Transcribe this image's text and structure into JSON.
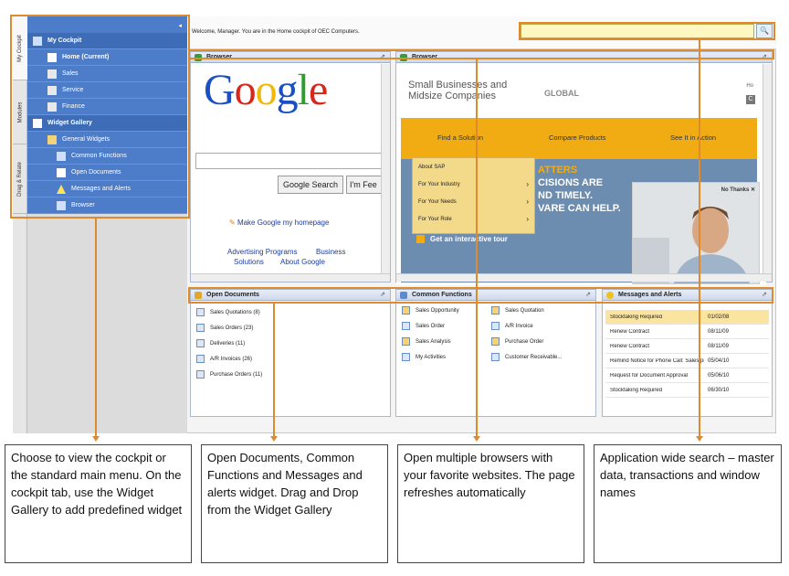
{
  "vtabs": [
    "My Cockpit",
    "Modules",
    "Drag & Relate"
  ],
  "menu": {
    "collapse_glyph": "◂",
    "items": [
      {
        "label": "My Cockpit",
        "bold": true,
        "indent": 6,
        "icon": "cockpit-icon"
      },
      {
        "label": "Home (Current)",
        "bold": true,
        "indent": 22,
        "icon": "home-icon"
      },
      {
        "label": "Sales",
        "bold": false,
        "indent": 22,
        "icon": "sales-icon"
      },
      {
        "label": "Service",
        "bold": false,
        "indent": 22,
        "icon": "service-icon"
      },
      {
        "label": "Finance",
        "bold": false,
        "indent": 22,
        "icon": "finance-icon"
      },
      {
        "label": "Widget Gallery",
        "bold": true,
        "indent": 6,
        "icon": "widget-gallery-icon"
      },
      {
        "label": "General Widgets",
        "bold": false,
        "indent": 22,
        "icon": "folder-icon"
      },
      {
        "label": "Common Functions",
        "bold": false,
        "indent": 32,
        "icon": "functions-icon"
      },
      {
        "label": "Open Documents",
        "bold": false,
        "indent": 32,
        "icon": "documents-icon"
      },
      {
        "label": "Messages and Alerts",
        "bold": false,
        "indent": 32,
        "icon": "alert-icon"
      },
      {
        "label": "Browser",
        "bold": false,
        "indent": 32,
        "icon": "browser-icon"
      }
    ]
  },
  "topbar": {
    "welcome": "Welcome, Manager. You are in the Home cockpit of OEC Computers.",
    "search_value": "",
    "search_button": "🔍"
  },
  "browser1": {
    "title": "Browser",
    "google_letters": [
      {
        "ch": "G",
        "color": "#1a4fc4"
      },
      {
        "ch": "o",
        "color": "#d8261b"
      },
      {
        "ch": "o",
        "color": "#f0b90a"
      },
      {
        "ch": "g",
        "color": "#1a4fc4"
      },
      {
        "ch": "l",
        "color": "#2b9e2b"
      },
      {
        "ch": "e",
        "color": "#d8261b"
      }
    ],
    "search_button": "Google Search",
    "lucky_button": "I'm Fee",
    "homepage_link": "Make Google my homepage",
    "link_ad": "Advertising Programs",
    "link_business": "Business",
    "link_solutions": "Solutions",
    "link_about": "About Google"
  },
  "browser2": {
    "title": "Browser",
    "header_line1": "Small Businesses and",
    "header_line2": "Midsize Companies",
    "global": "GLOBAL",
    "corner_text": "Ho",
    "corner_badge": "C",
    "nav": [
      "Find a Solution",
      "Compare Products",
      "See It in Action"
    ],
    "dropdown": [
      {
        "label": "About SAP",
        "arrow": ""
      },
      {
        "label": "For Your Industry",
        "arrow": "›"
      },
      {
        "label": "For Your Needs",
        "arrow": "›"
      },
      {
        "label": "For Your Role",
        "arrow": "›"
      }
    ],
    "big_lines": [
      "ATTERS",
      "CISIONS ARE",
      "ND TIMELY.",
      "VARE CAN HELP."
    ],
    "tour": "Get an interactive tour",
    "no_thanks": "No Thanks",
    "close_glyph": "✕"
  },
  "open_documents": {
    "title": "Open Documents",
    "items": [
      "Sales Quotations (8)",
      "Sales Orders (23)",
      "Deliveries (11)",
      "A/R Invoices (26)",
      "Purchase Orders (11)"
    ]
  },
  "common_functions": {
    "title": "Common Functions",
    "col1": [
      "Sales Opportunity",
      "Sales Order",
      "Sales Analysis",
      "My Activities"
    ],
    "col2": [
      "Sales Quotation",
      "A/R Invoice",
      "Purchase Order",
      "Customer Receivable..."
    ]
  },
  "messages_alerts": {
    "title": "Messages and Alerts",
    "rows": [
      {
        "name": "Stocktaking Required",
        "date": "01/02/08",
        "highlight": true
      },
      {
        "name": "Renew Contract",
        "date": "08/11/09",
        "highlight": false
      },
      {
        "name": "Renew Contract",
        "date": "08/11/09",
        "highlight": false
      },
      {
        "name": "Remind Notice for Phone Call: Sales pre",
        "date": "05/04/10",
        "highlight": false
      },
      {
        "name": "Request for Document Approval",
        "date": "05/06/10",
        "highlight": false
      },
      {
        "name": "Stocktaking Required",
        "date": "06/30/10",
        "highlight": false
      }
    ]
  },
  "pin_glyph": "⇗",
  "callouts": [
    "Choose to view the cockpit or the standard main menu. On the cockpit tab, use the Widget Gallery to add predefined widget",
    "Open Documents, Common Functions and Messages and alerts widget. Drag and Drop from the Widget Gallery",
    "Open multiple browsers with your favorite websites. The page refreshes automatically",
    "Application wide search – master data, transactions and window names"
  ],
  "colors": {
    "accent": "#e08a2e",
    "menu_blue": "#4d7cc9",
    "sap_orange": "#f0ac12",
    "search_yellow": "#fff7c2"
  }
}
